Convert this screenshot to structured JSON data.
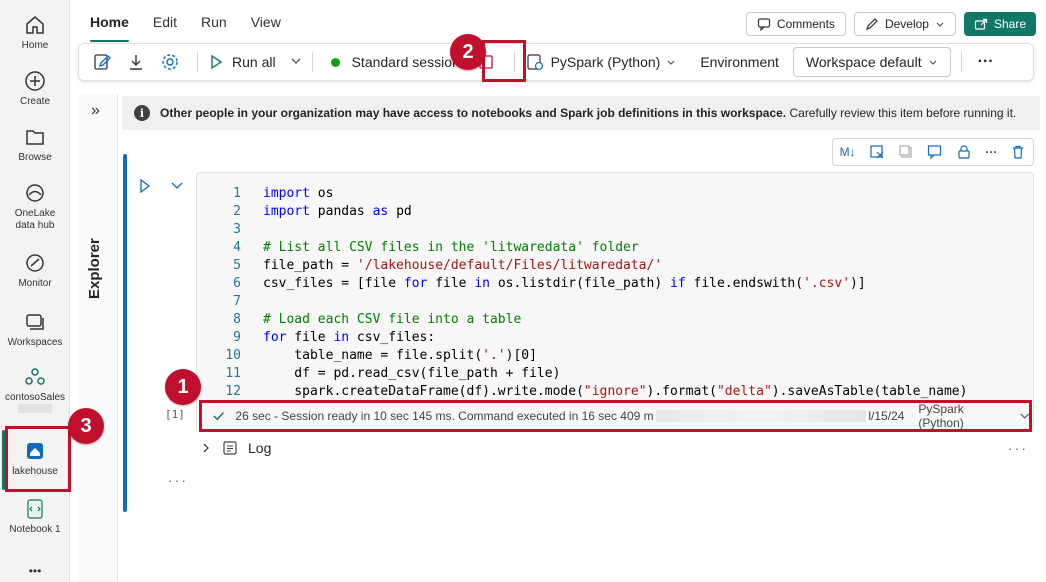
{
  "rail": {
    "items": [
      {
        "label": "Home",
        "icon": "home-icon"
      },
      {
        "label": "Create",
        "icon": "plus-circle-icon"
      },
      {
        "label": "Browse",
        "icon": "folder-icon"
      },
      {
        "label": "OneLake data hub",
        "icon": "onelake-icon"
      },
      {
        "label": "Monitor",
        "icon": "monitor-icon"
      },
      {
        "label": "Workspaces",
        "icon": "workspaces-icon"
      },
      {
        "label": "contosoSales",
        "icon": "workspace-group-icon"
      },
      {
        "label": "lakehouse",
        "icon": "lakehouse-icon"
      },
      {
        "label": "Notebook 1",
        "icon": "notebook-icon"
      }
    ],
    "more": "•••"
  },
  "tabs": [
    "Home",
    "Edit",
    "Run",
    "View"
  ],
  "top_right": {
    "comments": "Comments",
    "develop": "Develop",
    "share": "Share"
  },
  "toolbar": {
    "run_all": "Run all",
    "session": "Standard session",
    "language": "PySpark (Python)",
    "environment_label": "Environment",
    "environment_value": "Workspace default",
    "more": "···"
  },
  "explorer": {
    "label": "Explorer",
    "toggle": "»"
  },
  "info": {
    "bold": "Other people in your organization may have access to notebooks and Spark job definitions in this workspace.",
    "rest": " Carefully review this item before running it."
  },
  "code_lines": [
    {
      "n": "1",
      "parts": [
        {
          "c": "kw",
          "t": "import"
        },
        {
          "c": "tx",
          "t": " os"
        }
      ]
    },
    {
      "n": "2",
      "parts": [
        {
          "c": "kw",
          "t": "import"
        },
        {
          "c": "tx",
          "t": " pandas "
        },
        {
          "c": "kw",
          "t": "as"
        },
        {
          "c": "tx",
          "t": " pd"
        }
      ]
    },
    {
      "n": "3",
      "parts": []
    },
    {
      "n": "4",
      "parts": [
        {
          "c": "cm",
          "t": "# List all CSV files in the 'litwaredata' folder"
        }
      ]
    },
    {
      "n": "5",
      "parts": [
        {
          "c": "tx",
          "t": "file_path = "
        },
        {
          "c": "st",
          "t": "'/lakehouse/default/Files/litwaredata/'"
        }
      ]
    },
    {
      "n": "6",
      "parts": [
        {
          "c": "tx",
          "t": "csv_files = [file "
        },
        {
          "c": "kw",
          "t": "for"
        },
        {
          "c": "tx",
          "t": " file "
        },
        {
          "c": "kw",
          "t": "in"
        },
        {
          "c": "tx",
          "t": " os.listdir(file_path) "
        },
        {
          "c": "kw",
          "t": "if"
        },
        {
          "c": "tx",
          "t": " file.endswith("
        },
        {
          "c": "st",
          "t": "'.csv'"
        },
        {
          "c": "tx",
          "t": ")]"
        }
      ]
    },
    {
      "n": "7",
      "parts": []
    },
    {
      "n": "8",
      "parts": [
        {
          "c": "cm",
          "t": "# Load each CSV file into a table"
        }
      ]
    },
    {
      "n": "9",
      "parts": [
        {
          "c": "kw",
          "t": "for"
        },
        {
          "c": "tx",
          "t": " file "
        },
        {
          "c": "kw",
          "t": "in"
        },
        {
          "c": "tx",
          "t": " csv_files:"
        }
      ]
    },
    {
      "n": "10",
      "parts": [
        {
          "c": "tx",
          "t": "    table_name = file.split("
        },
        {
          "c": "st",
          "t": "'.'"
        },
        {
          "c": "tx",
          "t": ")[0]"
        }
      ]
    },
    {
      "n": "11",
      "parts": [
        {
          "c": "tx",
          "t": "    df = pd.read_csv(file_path + file)"
        }
      ]
    },
    {
      "n": "12",
      "parts": [
        {
          "c": "tx",
          "t": "    spark.createDataFrame(df).write.mode("
        },
        {
          "c": "st",
          "t": "\"ignore\""
        },
        {
          "c": "tx",
          "t": ").format("
        },
        {
          "c": "st",
          "t": "\"delta\""
        },
        {
          "c": "tx",
          "t": ").saveAsTable(table_name)"
        }
      ]
    }
  ],
  "cell": {
    "exec_count": "[1]",
    "status": "26 sec - Session ready in 10 sec 145 ms. Command executed in 16 sec 409 m",
    "status_date_tail": "l/15/24",
    "status_lang": "PySpark (Python)",
    "log": "Log",
    "more": "···",
    "below": "···"
  },
  "badges": {
    "one": "1",
    "two": "2",
    "three": "3"
  },
  "colors": {
    "accent": "#117865",
    "highlight": "#c0102e",
    "run_blue": "#0f6cbd"
  }
}
